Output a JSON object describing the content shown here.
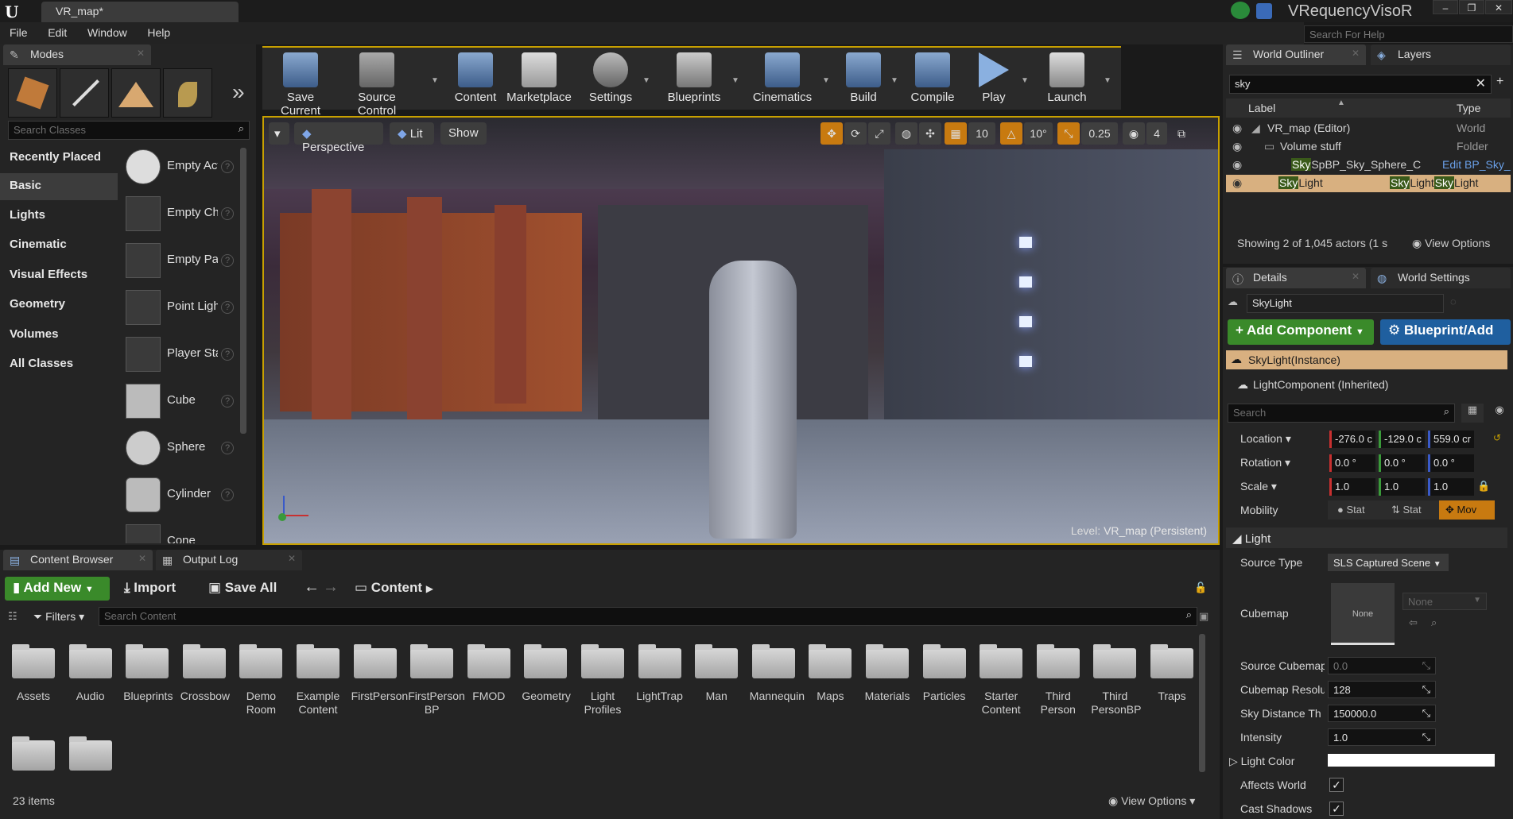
{
  "window": {
    "doc_tab": "VR_map*",
    "app_name": "VRequencyVisoR",
    "help_search_placeholder": "Search For Help"
  },
  "menu": [
    "File",
    "Edit",
    "Window",
    "Help"
  ],
  "modes": {
    "tab_label": "Modes",
    "search_placeholder": "Search Classes",
    "categories": [
      "Recently Placed",
      "Basic",
      "Lights",
      "Cinematic",
      "Visual Effects",
      "Geometry",
      "Volumes",
      "All Classes"
    ],
    "selected_category": "Basic",
    "items": [
      "Empty Actor",
      "Empty Character",
      "Empty Pawn",
      "Point Light",
      "Player Start",
      "Cube",
      "Sphere",
      "Cylinder",
      "Cone"
    ]
  },
  "toolbar": {
    "buttons": [
      "Save Current",
      "Source Control",
      "Content",
      "Marketplace",
      "Settings",
      "Blueprints",
      "Cinematics",
      "Build",
      "Compile",
      "Play",
      "Launch"
    ]
  },
  "viewport": {
    "perspective_label": "Perspective",
    "lit_label": "Lit",
    "show_label": "Show",
    "grid_snap": "10",
    "rotation_snap": "10°",
    "scale_snap": "0.25",
    "camera_speed": "4",
    "level_label": "Level:",
    "level_name": "VR_map (Persistent)"
  },
  "outliner": {
    "tab_label": "World Outliner",
    "layers_tab": "Layers",
    "search_value": "sky",
    "col_label": "Label",
    "col_type": "Type",
    "rows": [
      {
        "label": "VR_map (Editor)",
        "type": "World"
      },
      {
        "label": "Volume stuff",
        "type": "Folder"
      },
      {
        "label_hl": "Sky",
        "label_rest": "SpBP_Sky_Sphere_C",
        "type": "Edit BP_Sky_"
      },
      {
        "label_hl": "Sky",
        "label_rest": "Light",
        "type_hl1": "Sky",
        "type_rest1": "Light",
        "type_hl2": "Sky",
        "type_rest2": "Light"
      }
    ],
    "status": "Showing 2 of 1,045 actors (1 s",
    "view_options": "View Options"
  },
  "details": {
    "tab_label": "Details",
    "world_settings_tab": "World Settings",
    "name_value": "SkyLight",
    "add_component": "+ Add Component",
    "blueprint_add": "Blueprint/Add",
    "components": [
      "SkyLight(Instance)",
      "LightComponent (Inherited)"
    ],
    "search_placeholder": "Search",
    "transform": {
      "location_label": "Location",
      "location": [
        "-276.0 c",
        "-129.0 c",
        "559.0 cr"
      ],
      "rotation_label": "Rotation",
      "rotation": [
        "0.0 °",
        "0.0 °",
        "0.0 °"
      ],
      "scale_label": "Scale",
      "scale": [
        "1.0",
        "1.0",
        "1.0"
      ],
      "mobility_label": "Mobility",
      "mobility": [
        "Stat",
        "Stat",
        "Mov"
      ]
    },
    "light_section": "Light",
    "source_type_label": "Source Type",
    "source_type_value": "SLS Captured Scene",
    "cubemap_label": "Cubemap",
    "cubemap_thumb": "None",
    "cubemap_value": "None",
    "source_cubemap_label": "Source Cubemap",
    "source_cubemap_value": "0.0",
    "cubemap_res_label": "Cubemap Resolu",
    "cubemap_res_value": "128",
    "sky_distance_label": "Sky Distance Th",
    "sky_distance_value": "150000.0",
    "intensity_label": "Intensity",
    "intensity_value": "1.0",
    "light_color_label": "Light Color",
    "affects_world_label": "Affects World",
    "cast_shadows_label": "Cast Shadows"
  },
  "content_browser": {
    "tab_label": "Content Browser",
    "output_log_tab": "Output Log",
    "add_new": "Add New",
    "import": "Import",
    "save_all": "Save All",
    "path": "Content",
    "filters": "Filters",
    "search_placeholder": "Search Content",
    "folders": [
      "Assets",
      "Audio",
      "Blueprints",
      "Crossbow",
      "Demo Room",
      "Example Content",
      "FirstPerson",
      "FirstPerson BP",
      "FMOD",
      "Geometry",
      "Light Profiles",
      "LightTrap",
      "Man",
      "Mannequin",
      "Maps",
      "Materials",
      "Particles",
      "Starter Content",
      "Third Person",
      "Third PersonBP",
      "Traps",
      "",
      ""
    ],
    "item_count": "23 items",
    "view_options": "View Options"
  },
  "colors": {
    "accent": "#c8a000",
    "selection": "#d8b080",
    "green": "#3a8a2a",
    "blue": "#1f5f9f",
    "x_axis": "#c83030",
    "y_axis": "#3a9a3a",
    "z_axis": "#3a5ac8"
  }
}
